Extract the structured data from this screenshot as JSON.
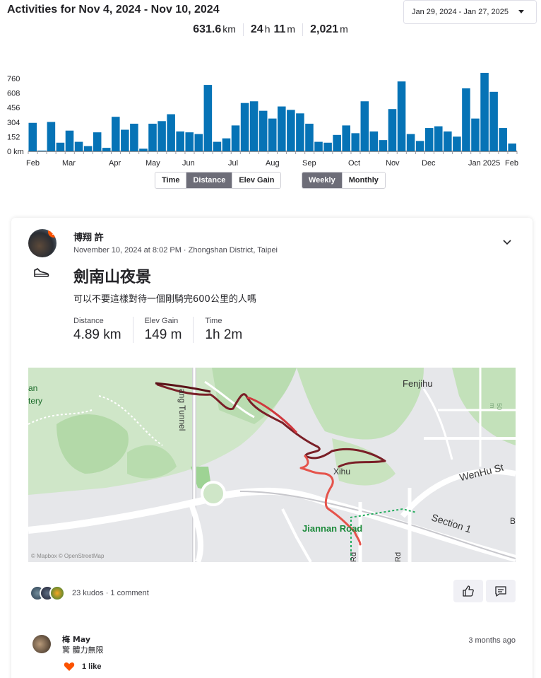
{
  "header": {
    "title": "Activities for Nov 4, 2024 - Nov 10, 2024",
    "range_label": "Jan 29, 2024 - Jan 27, 2025"
  },
  "totals": {
    "distance_value": "631.6",
    "distance_unit": "km",
    "time_hours": "24",
    "time_hours_unit": "h",
    "time_minutes": "11",
    "time_minutes_unit": "m",
    "elev_value": "2,021",
    "elev_unit": "m"
  },
  "chart_data": {
    "type": "bar",
    "y_ticks": [
      "760",
      "608",
      "456",
      "304",
      "152",
      "0 km"
    ],
    "ylim": [
      0,
      760
    ],
    "x_tick_labels": [
      "Feb",
      "Mar",
      "Apr",
      "May",
      "Jun",
      "Jul",
      "Aug",
      "Sep",
      "Oct",
      "Nov",
      "Dec",
      "Jan 2025",
      "Feb"
    ],
    "values": [
      330,
      5,
      340,
      100,
      240,
      110,
      60,
      220,
      40,
      400,
      250,
      320,
      30,
      320,
      350,
      430,
      230,
      220,
      200,
      770,
      110,
      150,
      300,
      560,
      580,
      470,
      380,
      520,
      480,
      440,
      320,
      110,
      100,
      190,
      300,
      210,
      580,
      230,
      130,
      490,
      810,
      200,
      120,
      270,
      290,
      230,
      170,
      730,
      380,
      910,
      690,
      270,
      90
    ],
    "highlight_color": "#0f8fda",
    "base_color": "#0673b6"
  },
  "chart_toggles": {
    "metric": [
      {
        "label": "Time",
        "active": false
      },
      {
        "label": "Distance",
        "active": true
      },
      {
        "label": "Elev Gain",
        "active": false
      }
    ],
    "period": [
      {
        "label": "Weekly",
        "active": true
      },
      {
        "label": "Monthly",
        "active": false
      }
    ]
  },
  "activity": {
    "athlete_name": "博翔 許",
    "meta": "November 10, 2024 at 8:02 PM · Zhongshan District, Taipei",
    "title": "劍南山夜景",
    "description": "可以不要這樣對待一個剛騎完600公里的人嗎",
    "stats": [
      {
        "label": "Distance",
        "value": "4.89 km"
      },
      {
        "label": "Elev Gain",
        "value": "149 m"
      },
      {
        "label": "Time",
        "value": "1h 2m"
      }
    ],
    "map_labels": {
      "fenjihu": "Fenjihu",
      "wenhu": "WenHu St",
      "section1": "Section 1",
      "xihu": "Xihu",
      "jiannan": "Jiannan Road",
      "tunnel": "ang Tunnel",
      "an": "an",
      "tery": "tery",
      "b": "B",
      "rd1": "Rd",
      "rd2": "Rd",
      "fifty": "50 m",
      "attribution": "© Mapbox © OpenStreetMap"
    },
    "kudos_text": "23 kudos · 1 comment"
  },
  "comment": {
    "name": "梅 May",
    "text": "驚 體力無限",
    "time": "3 months ago",
    "likes": "1 like"
  }
}
